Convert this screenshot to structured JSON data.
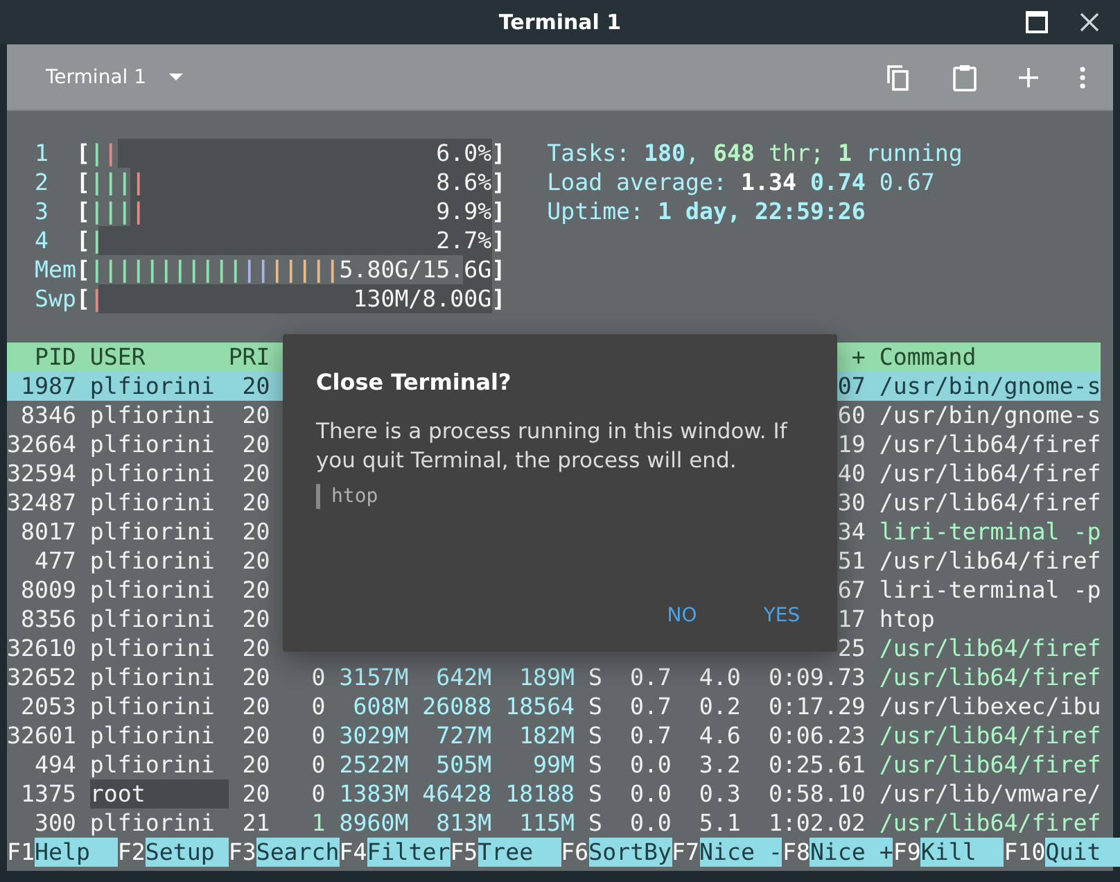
{
  "window": {
    "title": "Terminal 1"
  },
  "toolbar": {
    "tab_title": "Terminal 1"
  },
  "meter_brackets": [
    "[",
    "]"
  ],
  "meters": [
    {
      "label": "1",
      "level": 0.07,
      "value": "6.0%",
      "bars": [
        {
          "text": "|",
          "color": "#8fe0b0"
        },
        {
          "text": "|",
          "color": "#e08a8a"
        }
      ]
    },
    {
      "label": "2",
      "level": 0.1,
      "value": "8.6%",
      "bars": [
        {
          "text": "|",
          "color": "#8fe0b0"
        },
        {
          "text": "|",
          "color": "#8fe0b0"
        },
        {
          "text": "|",
          "color": "#8fe0b0"
        },
        {
          "text": "|",
          "color": "#e08a8a"
        }
      ]
    },
    {
      "label": "3",
      "level": 0.1,
      "value": "9.9%",
      "bars": [
        {
          "text": "|",
          "color": "#8fe0b0"
        },
        {
          "text": "|",
          "color": "#8fe0b0"
        },
        {
          "text": "|",
          "color": "#8fe0b0"
        },
        {
          "text": "|",
          "color": "#e08a8a"
        }
      ]
    },
    {
      "label": "4",
      "level": 0.02,
      "value": "2.7%",
      "bars": [
        {
          "text": "|",
          "color": "#8fe0b0"
        }
      ]
    },
    {
      "label": "Mem",
      "level": 0.93,
      "value": "5.80G/15.6G",
      "bars": [
        {
          "text": "|",
          "color": "#8fe0b0"
        },
        {
          "text": "|",
          "color": "#8fe0b0"
        },
        {
          "text": "|",
          "color": "#8fe0b0"
        },
        {
          "text": "|",
          "color": "#8fe0b0"
        },
        {
          "text": "|",
          "color": "#8fe0b0"
        },
        {
          "text": "|",
          "color": "#8fe0b0"
        },
        {
          "text": "|",
          "color": "#8fe0b0"
        },
        {
          "text": "|",
          "color": "#8fe0b0"
        },
        {
          "text": "|",
          "color": "#8fe0b0"
        },
        {
          "text": "|",
          "color": "#8fe0b0"
        },
        {
          "text": "|",
          "color": "#8fe0b0"
        },
        {
          "text": "|",
          "color": "#a9b4e6"
        },
        {
          "text": "|",
          "color": "#a9b4e6"
        },
        {
          "text": "|",
          "color": "#e6b98e"
        },
        {
          "text": "|",
          "color": "#e6b98e"
        },
        {
          "text": "|",
          "color": "#e6b98e"
        },
        {
          "text": "|",
          "color": "#e6b98e"
        },
        {
          "text": "|",
          "color": "#e6b98e"
        }
      ]
    },
    {
      "label": "Swp",
      "level": 0.02,
      "value": "130M/8.00G",
      "bars": [
        {
          "text": "|",
          "color": "#e08a8a"
        }
      ]
    }
  ],
  "info": [
    [
      {
        "text": "Tasks: ",
        "kind": "label"
      },
      {
        "text": "180",
        "kind": "value"
      },
      {
        "text": ", ",
        "kind": "label"
      },
      {
        "text": "648",
        "kind": "thread"
      },
      {
        "text": " thr; ",
        "kind": "threadlabel"
      },
      {
        "text": "1",
        "kind": "thread"
      },
      {
        "text": " running",
        "kind": "label"
      }
    ],
    [
      {
        "text": "Load average: ",
        "kind": "label"
      },
      {
        "text": "1.34 ",
        "kind": "bright"
      },
      {
        "text": "0.74",
        "kind": "value"
      },
      {
        "text": " 0.67",
        "kind": "label"
      }
    ],
    [
      {
        "text": "Uptime: ",
        "kind": "label"
      },
      {
        "text": "1 day, 22:59:26",
        "kind": "value"
      }
    ]
  ],
  "table": {
    "header": {
      "pid": "PID",
      "user": "USER",
      "pri": "PRI",
      "time": "+",
      "command": "Command"
    },
    "rows": [
      {
        "selected": true,
        "thread": false,
        "user_marked": false,
        "pid": "1987",
        "user": "plfiorini",
        "pri": "20",
        "time": "07",
        "command": "/usr/bin/gnome-s"
      },
      {
        "selected": false,
        "thread": false,
        "user_marked": false,
        "pid": "8346",
        "user": "plfiorini",
        "pri": "20",
        "time": "60",
        "command": "/usr/bin/gnome-s"
      },
      {
        "selected": false,
        "thread": false,
        "user_marked": false,
        "pid": "32664",
        "user": "plfiorini",
        "pri": "20",
        "time": "19",
        "command": "/usr/lib64/firef"
      },
      {
        "selected": false,
        "thread": false,
        "user_marked": false,
        "pid": "32594",
        "user": "plfiorini",
        "pri": "20",
        "time": "40",
        "command": "/usr/lib64/firef"
      },
      {
        "selected": false,
        "thread": false,
        "user_marked": false,
        "pid": "32487",
        "user": "plfiorini",
        "pri": "20",
        "time": "30",
        "command": "/usr/lib64/firef"
      },
      {
        "selected": false,
        "thread": true,
        "user_marked": false,
        "pid": "8017",
        "user": "plfiorini",
        "pri": "20",
        "time": "34",
        "command": "liri-terminal -p"
      },
      {
        "selected": false,
        "thread": false,
        "user_marked": false,
        "pid": "477",
        "user": "plfiorini",
        "pri": "20",
        "time": "51",
        "command": "/usr/lib64/firef"
      },
      {
        "selected": false,
        "thread": false,
        "user_marked": false,
        "pid": "8009",
        "user": "plfiorini",
        "pri": "20",
        "time": "67",
        "command": "liri-terminal -p"
      },
      {
        "selected": false,
        "thread": false,
        "user_marked": false,
        "pid": "8356",
        "user": "plfiorini",
        "pri": "20",
        "time": "17",
        "command": "htop"
      },
      {
        "selected": false,
        "thread": true,
        "user_marked": false,
        "pid": "32610",
        "user": "plfiorini",
        "pri": "20",
        "time": "25",
        "command": "/usr/lib64/firef"
      },
      {
        "selected": false,
        "thread": true,
        "user_marked": false,
        "niced": false,
        "pid": "32652",
        "user": "plfiorini",
        "pri": "20",
        "ni": "0",
        "virt": "3157M",
        "res": "642M",
        "shr": "189M",
        "s": "S",
        "cpu": "0.7",
        "mem": "4.0",
        "time": "0:09.73",
        "command": "/usr/lib64/firef"
      },
      {
        "selected": false,
        "thread": false,
        "user_marked": false,
        "niced": false,
        "pid": "2053",
        "user": "plfiorini",
        "pri": "20",
        "ni": "0",
        "virt": "608M",
        "res": "26088",
        "shr": "18564",
        "s": "S",
        "cpu": "0.7",
        "mem": "0.2",
        "time": "0:17.29",
        "command": "/usr/libexec/ibu"
      },
      {
        "selected": false,
        "thread": true,
        "user_marked": false,
        "niced": false,
        "pid": "32601",
        "user": "plfiorini",
        "pri": "20",
        "ni": "0",
        "virt": "3029M",
        "res": "727M",
        "shr": "182M",
        "s": "S",
        "cpu": "0.7",
        "mem": "4.6",
        "time": "0:06.23",
        "command": "/usr/lib64/firef"
      },
      {
        "selected": false,
        "thread": true,
        "user_marked": false,
        "niced": false,
        "pid": "494",
        "user": "plfiorini",
        "pri": "20",
        "ni": "0",
        "virt": "2522M",
        "res": "505M",
        "shr": "99M",
        "s": "S",
        "cpu": "0.0",
        "mem": "3.2",
        "time": "0:25.61",
        "command": "/usr/lib64/firef"
      },
      {
        "selected": false,
        "thread": false,
        "user_marked": true,
        "niced": false,
        "pid": "1375",
        "user": "root",
        "pri": "20",
        "ni": "0",
        "virt": "1383M",
        "res": "46428",
        "shr": "18188",
        "s": "S",
        "cpu": "0.0",
        "mem": "0.3",
        "time": "0:58.10",
        "command": "/usr/lib/vmware/"
      },
      {
        "selected": false,
        "thread": true,
        "user_marked": false,
        "niced": true,
        "pid": "300",
        "user": "plfiorini",
        "pri": "21",
        "ni": "1",
        "virt": "8960M",
        "res": "813M",
        "shr": "115M",
        "s": "S",
        "cpu": "0.0",
        "mem": "5.1",
        "time": "1:02.02",
        "command": "/usr/lib64/firef"
      }
    ]
  },
  "function_keys": [
    {
      "key": "F1",
      "label": "Help"
    },
    {
      "key": "F2",
      "label": "Setup"
    },
    {
      "key": "F3",
      "label": "Search"
    },
    {
      "key": "F4",
      "label": "Filter"
    },
    {
      "key": "F5",
      "label": "Tree"
    },
    {
      "key": "F6",
      "label": "SortBy"
    },
    {
      "key": "F7",
      "label": "Nice -"
    },
    {
      "key": "F8",
      "label": "Nice +"
    },
    {
      "key": "F9",
      "label": "Kill"
    },
    {
      "key": "F10",
      "label": "Quit"
    }
  ],
  "dialog": {
    "title": "Close Terminal?",
    "message": "There is a process running in this window. If you quit Terminal, the process will end.",
    "process": "htop",
    "buttons": [
      "NO",
      "YES"
    ]
  }
}
